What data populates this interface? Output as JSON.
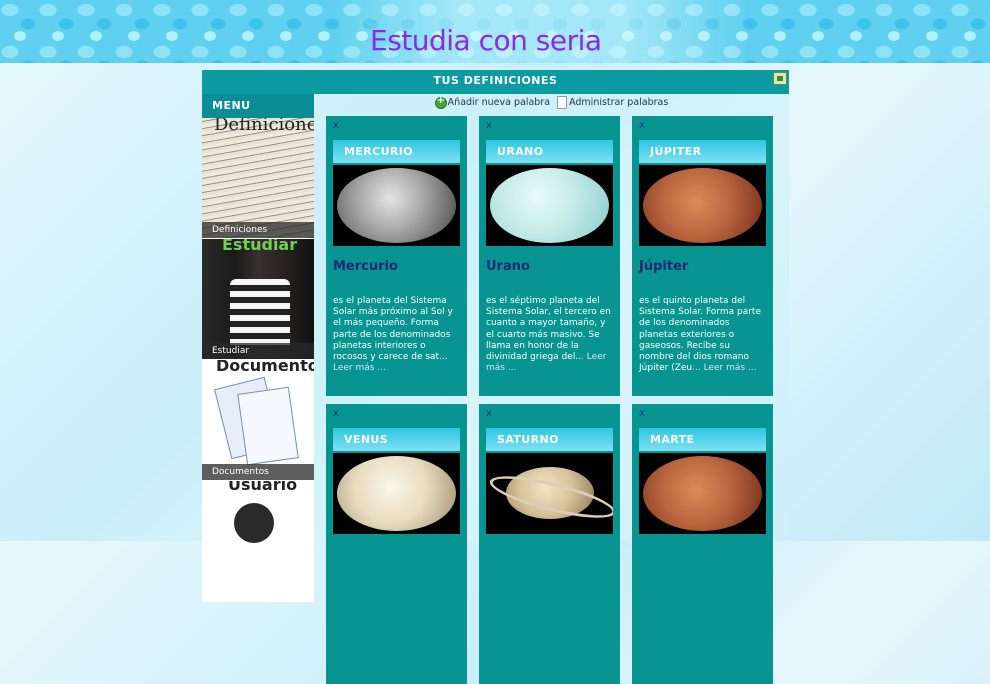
{
  "site": {
    "title": "Estudia con seria"
  },
  "header": {
    "title": "TUS DEFINICIONES",
    "exit_icon": "exit-icon"
  },
  "menu": {
    "title": "MENU",
    "items": [
      {
        "label": "Definiciones",
        "image_text": "Definiciones"
      },
      {
        "label": "Estudiar",
        "image_text": "Estudiar"
      },
      {
        "label": "Documentos",
        "image_text": "Documentos"
      },
      {
        "label": "",
        "image_text": "Usuario"
      }
    ]
  },
  "toolbar": {
    "add_label": "Añadir nueva palabra",
    "manage_label": "Administrar palabras"
  },
  "cards": [
    {
      "close": "x",
      "header": "MERCURIO",
      "name": "Mercurio",
      "desc": "es el planeta del Sistema Solar más próximo al Sol y el más pequeño. Forma parte de los denominados planetas interiores o rocosos y carece de sat...",
      "more": "Leer más ..."
    },
    {
      "close": "x",
      "header": "URANO",
      "name": "Urano",
      "desc": "es el séptimo planeta del Sistema Solar, el tercero en cuanto a mayor tamaño, y el cuarto más masivo. Se llama en honor de la divinidad griega del...",
      "more": "Leer más ..."
    },
    {
      "close": "x",
      "header": "JÚPITER",
      "name": "Júpiter",
      "desc": "es el quinto planeta del Sistema Solar. Forma parte de los denominados planetas exteriores o gaseosos. Recibe su nombre del dios romano Júpiter (Zeu...",
      "more": "Leer más ..."
    },
    {
      "close": "x",
      "header": "VENUS"
    },
    {
      "close": "x",
      "header": "SATURNO"
    },
    {
      "close": "x",
      "header": "MARTE"
    }
  ]
}
